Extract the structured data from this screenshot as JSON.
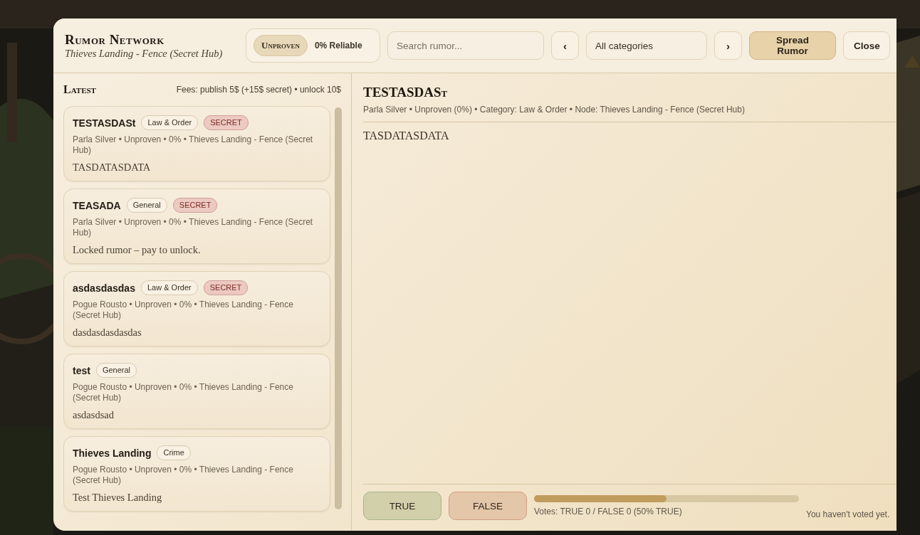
{
  "app": {
    "title": "Rumor Network",
    "subtitle": "Thieves Landing - Fence (Secret Hub)"
  },
  "status": {
    "badge": "Unproven",
    "reliability": "0% Reliable"
  },
  "search": {
    "placeholder": "Search rumor..."
  },
  "category_filter": {
    "prev": "‹",
    "value": "All categories",
    "next": "›"
  },
  "buttons": [
    {
      "label": "Spread Rumor",
      "kind": "primary"
    },
    {
      "label": "Close",
      "kind": "plain"
    }
  ],
  "list": {
    "heading": "Latest",
    "fees": "Fees: publish 5$ (+15$ secret) • unlock 10$",
    "items": [
      {
        "title": "TESTASDASt",
        "tags": [
          {
            "label": "Law & Order",
            "kind": "category"
          },
          {
            "label": "SECRET",
            "kind": "secret"
          }
        ],
        "meta": "Parla Silver • Unproven • 0% • Thieves Landing - Fence (Secret Hub)",
        "body": "TASDATASDATA"
      },
      {
        "title": "TEASADA",
        "tags": [
          {
            "label": "General",
            "kind": "category"
          },
          {
            "label": "SECRET",
            "kind": "secret"
          }
        ],
        "meta": "Parla Silver • Unproven • 0% • Thieves Landing - Fence (Secret Hub)",
        "body": "Locked rumor – pay to unlock."
      },
      {
        "title": "asdasdasdas",
        "tags": [
          {
            "label": "Law & Order",
            "kind": "category"
          },
          {
            "label": "SECRET",
            "kind": "secret"
          }
        ],
        "meta": "Pogue Rousto • Unproven • 0% • Thieves Landing - Fence (Secret Hub)",
        "body": "dasdasdasdasdas"
      },
      {
        "title": "test",
        "tags": [
          {
            "label": "General",
            "kind": "category"
          }
        ],
        "meta": "Pogue Rousto • Unproven • 0% • Thieves Landing - Fence (Secret Hub)",
        "body": "asdasdsad"
      },
      {
        "title": "Thieves Landing",
        "tags": [
          {
            "label": "Crime",
            "kind": "category"
          }
        ],
        "meta": "Pogue Rousto • Unproven • 0% • Thieves Landing - Fence (Secret Hub)",
        "body": "Test Thieves Landing"
      }
    ]
  },
  "detail": {
    "title": "TESTASDASt",
    "meta": "Parla Silver • Unproven (0%) • Category: Law & Order • Node: Thieves Landing - Fence (Secret Hub)",
    "body": "TASDATASDATA"
  },
  "vote": {
    "buttons": [
      {
        "label": "TRUE",
        "kind": "true"
      },
      {
        "label": "FALSE",
        "kind": "false"
      }
    ],
    "level": 0.5,
    "summary": "Votes: TRUE 0 / FALSE 0 (50% TRUE)",
    "status": "You haven't voted yet."
  }
}
